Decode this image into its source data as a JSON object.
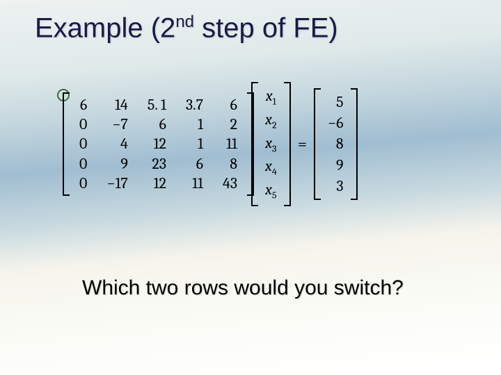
{
  "title": {
    "pre": "Example (2",
    "sup": "nd",
    "post": " step of FE)"
  },
  "matrix": {
    "rows": [
      [
        "6",
        "14",
        "5. 1",
        "3.7",
        "6"
      ],
      [
        "0",
        "−7",
        "6",
        "1",
        "2"
      ],
      [
        "0",
        "4",
        "12",
        "1",
        "11"
      ],
      [
        "0",
        "9",
        "23",
        "6",
        "8"
      ],
      [
        "0",
        "−17",
        "12",
        "11",
        "43"
      ]
    ]
  },
  "vector_x": [
    "x1",
    "x2",
    "x3",
    "x4",
    "x5"
  ],
  "equals": "=",
  "rhs": [
    "5",
    "−6",
    "8",
    "9",
    "3"
  ],
  "question": "Which two rows would you switch?"
}
